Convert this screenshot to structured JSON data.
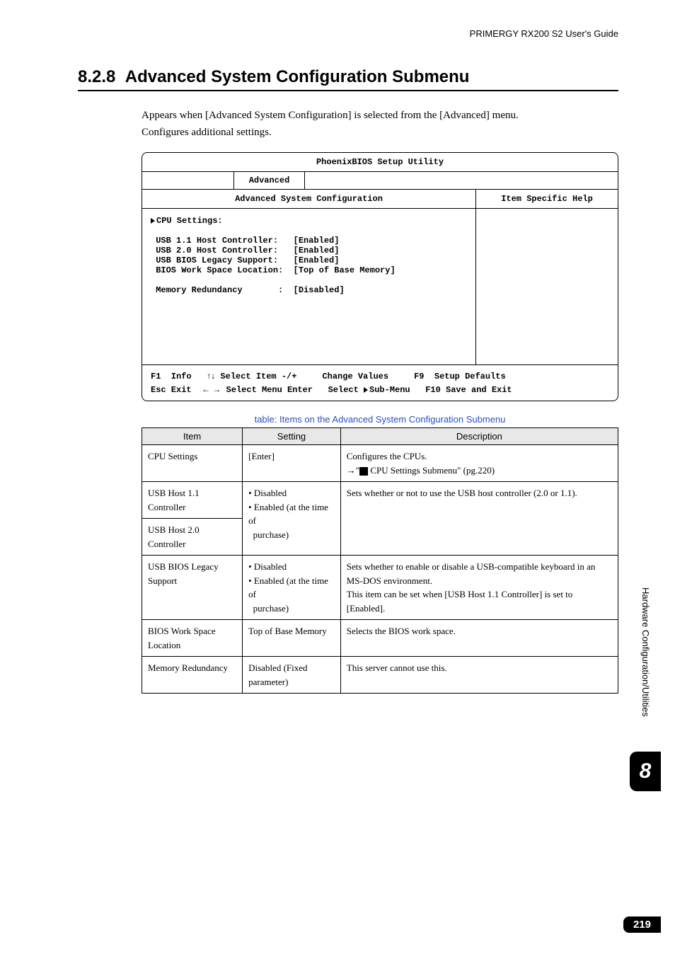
{
  "header": {
    "guide": "PRIMERGY RX200 S2 User's Guide"
  },
  "section": {
    "number": "8.2.8",
    "title": "Advanced System Configuration Submenu",
    "intro1": "Appears when [Advanced System Configuration] is selected from the [Advanced] menu.",
    "intro2": "Configures additional settings."
  },
  "bios": {
    "utility_title": "PhoenixBIOS Setup Utility",
    "tab": "Advanced",
    "panel_title": "Advanced System Configuration",
    "help_title": "Item Specific Help",
    "lines": {
      "cpu_settings": "CPU Settings:",
      "l1": "USB 1.1 Host Controller:   [Enabled]",
      "l2": "USB 2.0 Host Controller:   [Enabled]",
      "l3": "USB BIOS Legacy Support:   [Enabled]",
      "l4": "BIOS Work Space Location:  [Top of Base Memory]",
      "l5": "Memory Redundancy       :  [Disabled]"
    },
    "footer": {
      "f1a": "F1  Info   ",
      "f1b": " Select Item -/+     Change Values     F9  Setup Defaults",
      "f2a": "Esc Exit  ",
      "f2b": " Select Menu Enter   Select ",
      "f2c": "Sub-Menu   F10 Save and Exit"
    }
  },
  "config_table": {
    "caption": "table: Items on the Advanced System Configuration Submenu",
    "headers": {
      "item": "Item",
      "setting": "Setting",
      "description": "Description"
    },
    "rows": [
      {
        "item": "CPU Settings",
        "setting": "[Enter]",
        "desc_line1": "Configures the CPUs.",
        "desc_line2a": "→\"",
        "desc_line2b": " CPU Settings Submenu\" (pg.220)"
      },
      {
        "item": "USB Host 1.1 Controller",
        "item2": "USB Host 2.0 Controller",
        "setting": "• Disabled\n• Enabled (at the time of purchase)",
        "desc": "Sets whether or not to use the USB host controller (2.0 or 1.1)."
      },
      {
        "item": "USB BIOS Legacy Support",
        "setting": "• Disabled\n• Enabled (at the time of purchase)",
        "desc": "Sets whether to enable or disable a USB-compatible keyboard in an MS-DOS environment.\nThis item can be set when [USB Host 1.1 Controller] is set to [Enabled]."
      },
      {
        "item": "BIOS Work Space Location",
        "setting": "Top of Base Memory",
        "desc": "Selects the BIOS work space."
      },
      {
        "item": "Memory Redundancy",
        "setting": "Disabled (Fixed parameter)",
        "desc": "This server cannot use this."
      }
    ]
  },
  "side": {
    "text": "Hardware Configuration/Utilities"
  },
  "chapter": "8",
  "page_number": "219"
}
